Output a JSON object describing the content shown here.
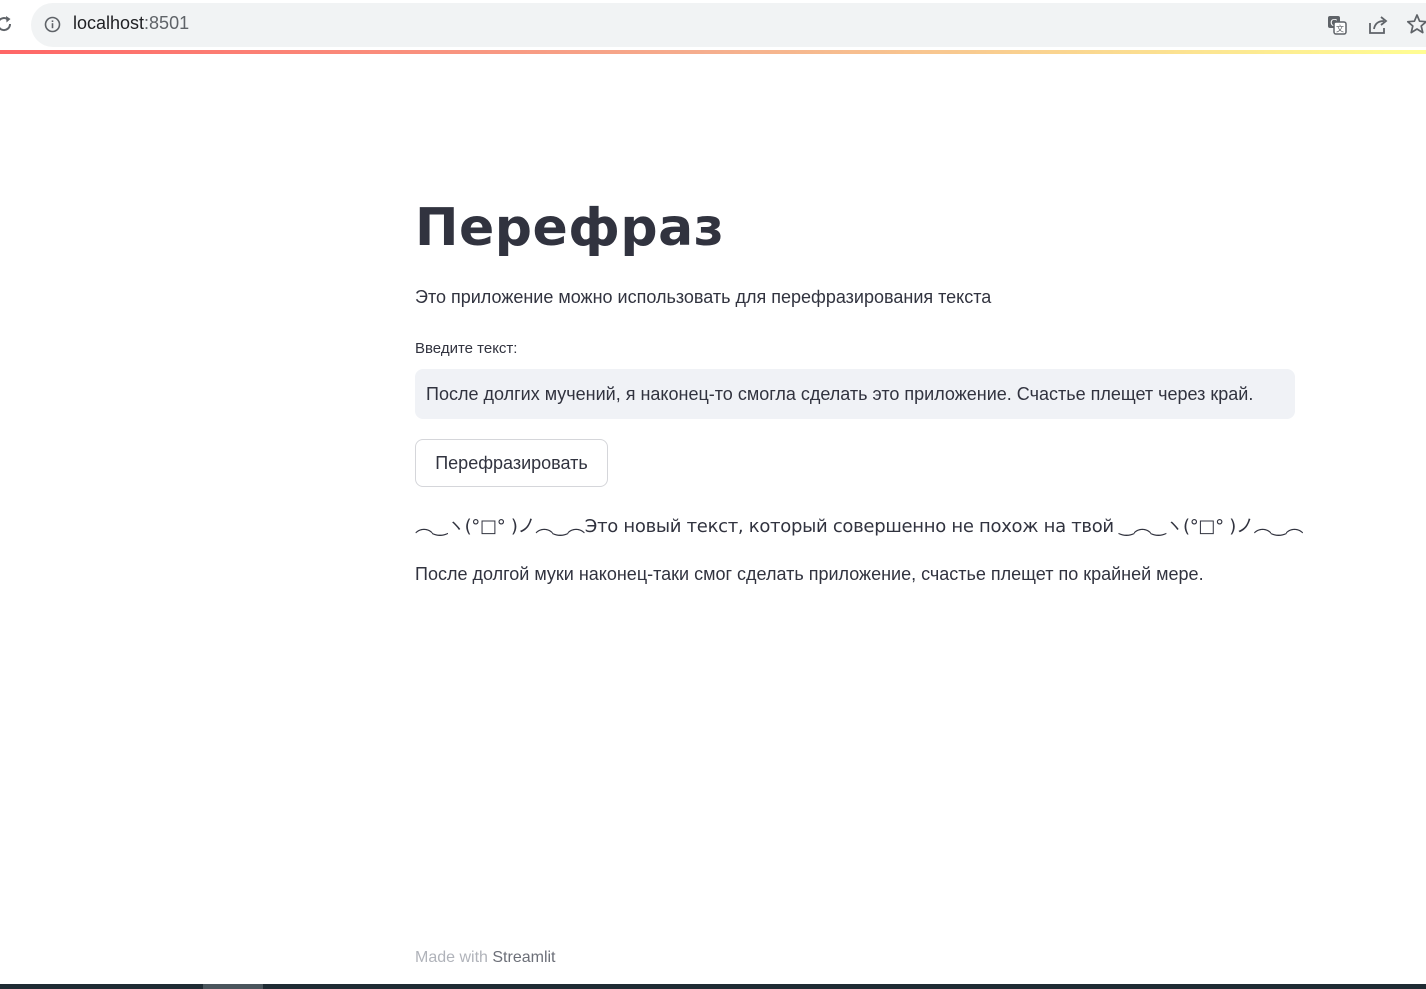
{
  "browser": {
    "url_host": "localhost",
    "url_port": ":8501"
  },
  "page": {
    "title": "Перефраз",
    "subtitle": "Это приложение можно использовать для перефразирования текста",
    "input_label": "Введите текст:",
    "input_value": "После долгих мучений, я наконец-то смогла сделать это приложение. Счастье плещет через край.",
    "button_label": "Перефразировать",
    "result_header": "︵‿ヽ(°□° )ノ︵‿︵Это новый текст, который совершенно не похож на твой ‿︵‿ヽ(°□° )ノ︵‿︵",
    "result_text": "После долгой муки наконец-таки смог сделать приложение, счастье плещет по крайней мере."
  },
  "footer": {
    "prefix": "Made with ",
    "link": "Streamlit"
  },
  "icons": {
    "reload": "reload-icon",
    "info": "info-icon",
    "translate": "translate-icon",
    "share": "share-icon",
    "star": "star-icon"
  },
  "colors": {
    "text": "#31333f",
    "input_bg": "#f0f2f6",
    "gradient_start": "#ff4b4b",
    "gradient_end": "#fffd80"
  }
}
